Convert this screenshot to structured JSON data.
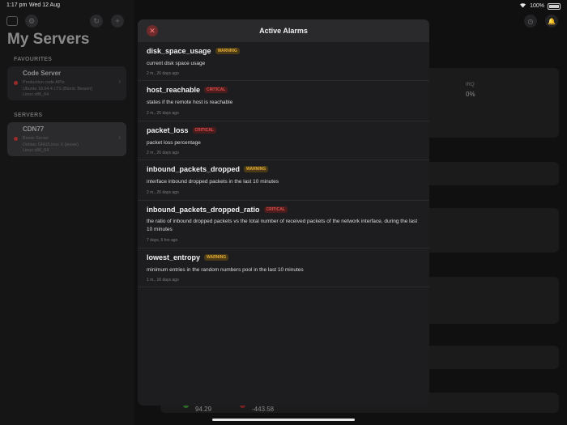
{
  "status": {
    "time": "1:17 pm",
    "date": "Wed 12 Aug",
    "battery": "100%"
  },
  "sidebar": {
    "title": "My Servers",
    "favourites_header": "FAVOURITES",
    "servers_header": "SERVERS",
    "favourites": [
      {
        "name": "Code Server",
        "lines": [
          "Production code APIs",
          "Ubuntu 18.04.4 LTS (Bionic Beaver)",
          "Linux x86_64"
        ]
      }
    ],
    "servers": [
      {
        "name": "CDN77",
        "lines": [
          "Bionic Server",
          "Debian GNU/Linux X (jessie)",
          "Linux x86_64"
        ]
      }
    ]
  },
  "background": {
    "irq_label": "IRQ",
    "irq_value": "0%",
    "stat_up": "94.29",
    "stat_down": "-443.58"
  },
  "modal": {
    "title": "Active Alarms",
    "alarms": [
      {
        "name": "disk_space_usage",
        "level": "WARNING",
        "description": "current disk space usage",
        "time": "2 m., 26 days ago"
      },
      {
        "name": "host_reachable",
        "level": "CRITICAL",
        "description": "states if the remote host is reachable",
        "time": "2 m., 26 days ago"
      },
      {
        "name": "packet_loss",
        "level": "CRITICAL",
        "description": "packet loss percentage",
        "time": "2 m., 26 days ago"
      },
      {
        "name": "inbound_packets_dropped",
        "level": "WARNING",
        "description": "interface inbound dropped packets in the last 10 minutes",
        "time": "2 m., 26 days ago"
      },
      {
        "name": "inbound_packets_dropped_ratio",
        "level": "CRITICAL",
        "description": "the ratio of inbound dropped packets vs the total number of received packets of the network interface, during the last 10 minutes",
        "time": "7 days, 6 hrs ago"
      },
      {
        "name": "lowest_entropy",
        "level": "WARNING",
        "description": "minimum entries in the random numbers pool in the last 10 minutes",
        "time": "1 m., 16 days ago"
      }
    ]
  }
}
